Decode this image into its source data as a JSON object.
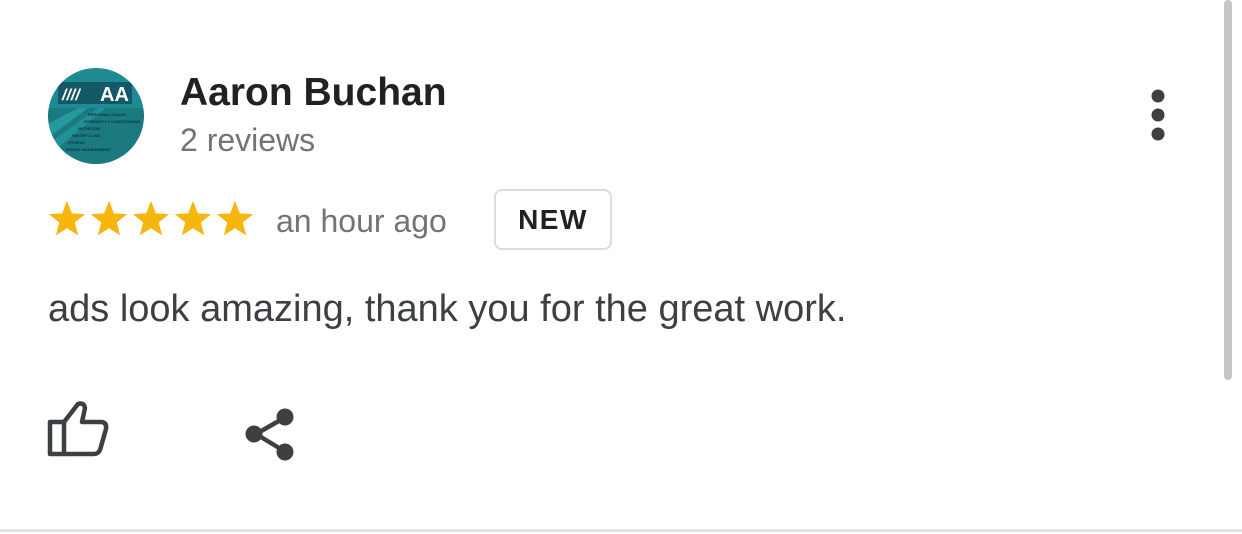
{
  "review": {
    "author": {
      "name": "Aaron Buchan",
      "reviews_count": "2 reviews",
      "avatar": {
        "icon": "avatar-logo",
        "initials": "AA",
        "slashes": "////",
        "lines": [
          "PERSONAL COACH",
          "STRENGTH & CONDITIONING",
          "NUTRITION",
          "WEIGHT LOSS",
          "FITNESS",
          "INJURY MANAGEMENT"
        ]
      }
    },
    "rating": 5,
    "rating_max": 5,
    "time_ago": "an hour ago",
    "badge": "NEW",
    "text": "ads look amazing, thank you for the great work."
  },
  "actions": {
    "more_icon": "more-vert-icon",
    "like_icon": "thumb-up-icon",
    "share_icon": "share-icon"
  },
  "colors": {
    "star": "#f6b60d",
    "name": "#202124",
    "secondary_text": "#70757a",
    "body_text": "#3c4043",
    "badge_border": "#dadce0",
    "icon": "#3c4043",
    "avatar_bg": "#1c7f86",
    "avatar_dark": "#0f3040"
  }
}
